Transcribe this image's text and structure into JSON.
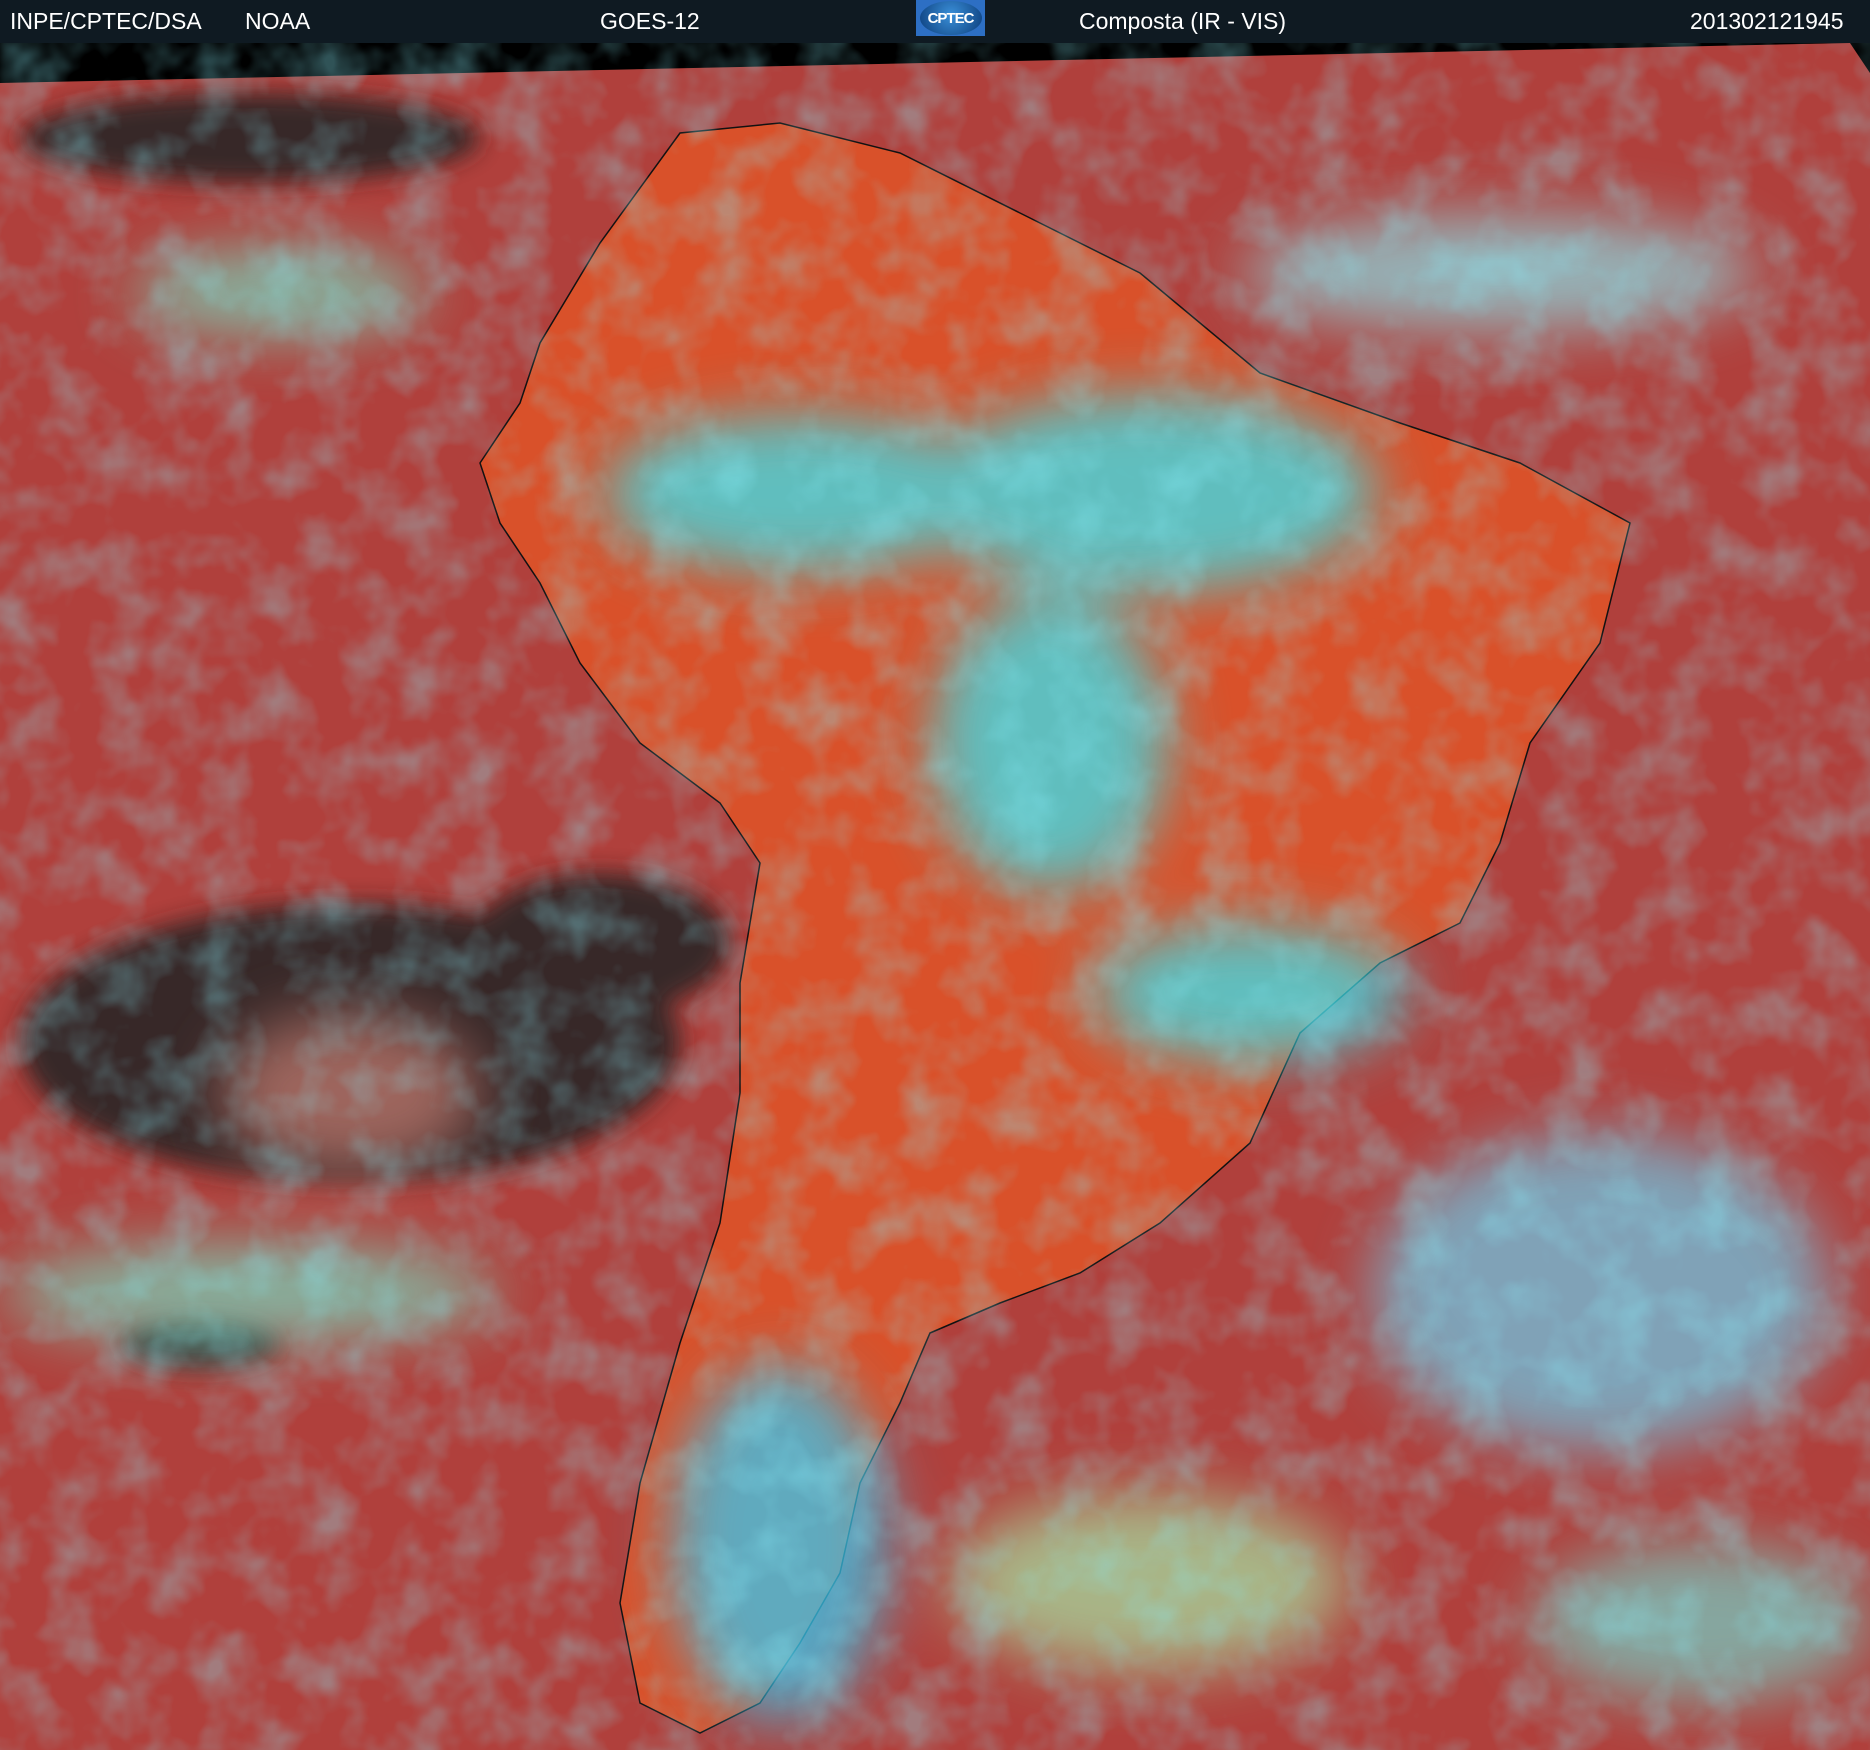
{
  "header": {
    "source": "INPE/CPTEC/DSA",
    "agency": "NOAA",
    "satellite": "GOES-12",
    "logo_text": "CPTEC",
    "product": "Composta (IR - VIS)",
    "timestamp": "201302121945"
  },
  "colors": {
    "header_bg": "#0f1a22",
    "ocean": "#b0403c",
    "land": "#d9512a",
    "cloud_cyan": "#39e3f0",
    "cloud_green": "#9be07a",
    "clear_dark": "#2a2526"
  }
}
